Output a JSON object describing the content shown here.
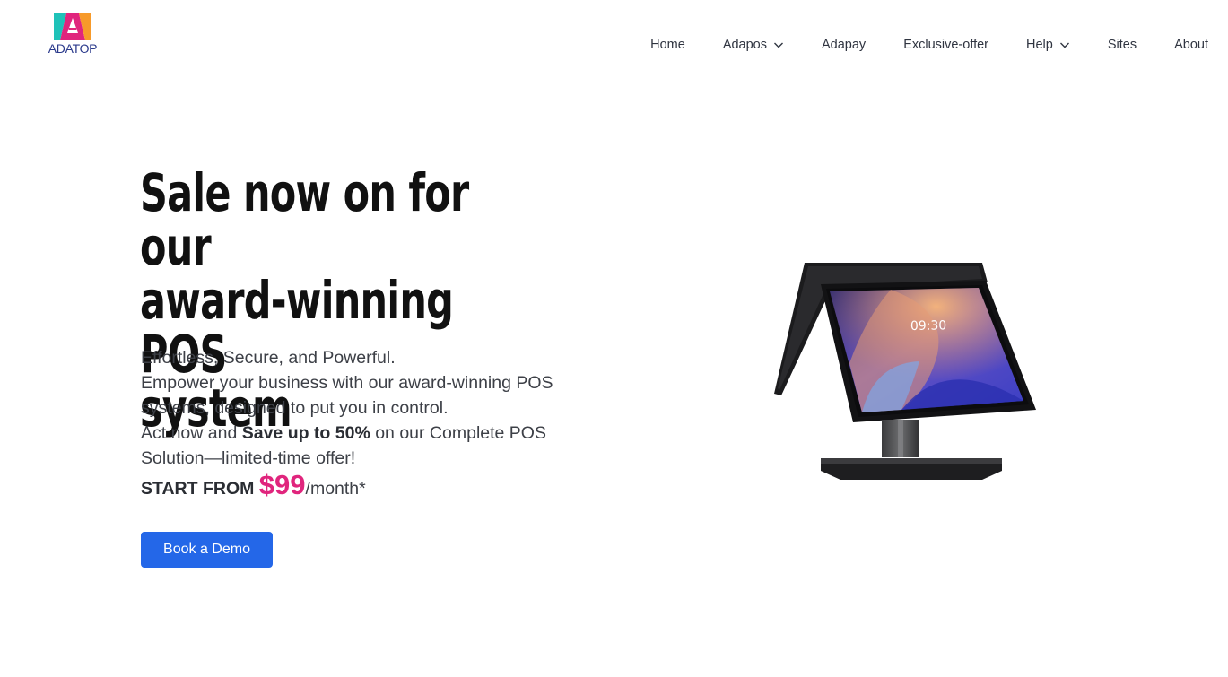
{
  "brand": {
    "logo_letter": "A",
    "logo_text": "ADATOP",
    "colors": {
      "primary": "#2b3a8c",
      "teal": "#1fc2b8",
      "pink": "#e0257d",
      "orange": "#f79a2a"
    }
  },
  "nav": {
    "items": [
      {
        "label": "Home",
        "has_dropdown": false
      },
      {
        "label": "Adapos",
        "has_dropdown": true
      },
      {
        "label": "Adapay",
        "has_dropdown": false
      },
      {
        "label": "Exclusive-offer",
        "has_dropdown": false
      },
      {
        "label": "Help",
        "has_dropdown": true
      },
      {
        "label": "Sites",
        "has_dropdown": false
      },
      {
        "label": "About",
        "has_dropdown": false
      }
    ]
  },
  "hero": {
    "title_line1": "Sale now on for our",
    "title_line2": "award-winning POS",
    "title_line3": "system",
    "line1": "Effortless, Secure, and Powerful.",
    "line2": "Empower your business with our award-winning POS systems, designed to put you in control.",
    "line3_pre": "Act now and ",
    "line3_bold": "Save up to 50%",
    "line3_post": " on our Complete POS Solution—limited-time offer!",
    "price_lead": "START FROM ",
    "price_amount": "$99",
    "price_suffix": "/month*",
    "cta_label": "Book a Demo"
  },
  "product_image": {
    "screen_time": "09:30",
    "accent_colors": [
      "#e9a071",
      "#6f57c9",
      "#3b3fc4",
      "#7fa7e6"
    ]
  }
}
